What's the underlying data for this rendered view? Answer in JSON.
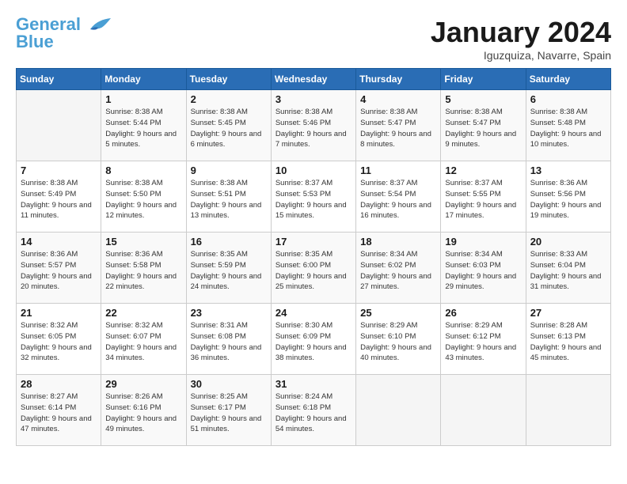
{
  "logo": {
    "line1": "General",
    "line2": "Blue"
  },
  "title": "January 2024",
  "location": "Iguzquiza, Navarre, Spain",
  "weekdays": [
    "Sunday",
    "Monday",
    "Tuesday",
    "Wednesday",
    "Thursday",
    "Friday",
    "Saturday"
  ],
  "weeks": [
    [
      {
        "day": null
      },
      {
        "day": 1,
        "sunrise": "8:38 AM",
        "sunset": "5:44 PM",
        "daylight": "9 hours and 5 minutes."
      },
      {
        "day": 2,
        "sunrise": "8:38 AM",
        "sunset": "5:45 PM",
        "daylight": "9 hours and 6 minutes."
      },
      {
        "day": 3,
        "sunrise": "8:38 AM",
        "sunset": "5:46 PM",
        "daylight": "9 hours and 7 minutes."
      },
      {
        "day": 4,
        "sunrise": "8:38 AM",
        "sunset": "5:47 PM",
        "daylight": "9 hours and 8 minutes."
      },
      {
        "day": 5,
        "sunrise": "8:38 AM",
        "sunset": "5:47 PM",
        "daylight": "9 hours and 9 minutes."
      },
      {
        "day": 6,
        "sunrise": "8:38 AM",
        "sunset": "5:48 PM",
        "daylight": "9 hours and 10 minutes."
      }
    ],
    [
      {
        "day": 7,
        "sunrise": "8:38 AM",
        "sunset": "5:49 PM",
        "daylight": "9 hours and 11 minutes."
      },
      {
        "day": 8,
        "sunrise": "8:38 AM",
        "sunset": "5:50 PM",
        "daylight": "9 hours and 12 minutes."
      },
      {
        "day": 9,
        "sunrise": "8:38 AM",
        "sunset": "5:51 PM",
        "daylight": "9 hours and 13 minutes."
      },
      {
        "day": 10,
        "sunrise": "8:37 AM",
        "sunset": "5:53 PM",
        "daylight": "9 hours and 15 minutes."
      },
      {
        "day": 11,
        "sunrise": "8:37 AM",
        "sunset": "5:54 PM",
        "daylight": "9 hours and 16 minutes."
      },
      {
        "day": 12,
        "sunrise": "8:37 AM",
        "sunset": "5:55 PM",
        "daylight": "9 hours and 17 minutes."
      },
      {
        "day": 13,
        "sunrise": "8:36 AM",
        "sunset": "5:56 PM",
        "daylight": "9 hours and 19 minutes."
      }
    ],
    [
      {
        "day": 14,
        "sunrise": "8:36 AM",
        "sunset": "5:57 PM",
        "daylight": "9 hours and 20 minutes."
      },
      {
        "day": 15,
        "sunrise": "8:36 AM",
        "sunset": "5:58 PM",
        "daylight": "9 hours and 22 minutes."
      },
      {
        "day": 16,
        "sunrise": "8:35 AM",
        "sunset": "5:59 PM",
        "daylight": "9 hours and 24 minutes."
      },
      {
        "day": 17,
        "sunrise": "8:35 AM",
        "sunset": "6:00 PM",
        "daylight": "9 hours and 25 minutes."
      },
      {
        "day": 18,
        "sunrise": "8:34 AM",
        "sunset": "6:02 PM",
        "daylight": "9 hours and 27 minutes."
      },
      {
        "day": 19,
        "sunrise": "8:34 AM",
        "sunset": "6:03 PM",
        "daylight": "9 hours and 29 minutes."
      },
      {
        "day": 20,
        "sunrise": "8:33 AM",
        "sunset": "6:04 PM",
        "daylight": "9 hours and 31 minutes."
      }
    ],
    [
      {
        "day": 21,
        "sunrise": "8:32 AM",
        "sunset": "6:05 PM",
        "daylight": "9 hours and 32 minutes."
      },
      {
        "day": 22,
        "sunrise": "8:32 AM",
        "sunset": "6:07 PM",
        "daylight": "9 hours and 34 minutes."
      },
      {
        "day": 23,
        "sunrise": "8:31 AM",
        "sunset": "6:08 PM",
        "daylight": "9 hours and 36 minutes."
      },
      {
        "day": 24,
        "sunrise": "8:30 AM",
        "sunset": "6:09 PM",
        "daylight": "9 hours and 38 minutes."
      },
      {
        "day": 25,
        "sunrise": "8:29 AM",
        "sunset": "6:10 PM",
        "daylight": "9 hours and 40 minutes."
      },
      {
        "day": 26,
        "sunrise": "8:29 AM",
        "sunset": "6:12 PM",
        "daylight": "9 hours and 43 minutes."
      },
      {
        "day": 27,
        "sunrise": "8:28 AM",
        "sunset": "6:13 PM",
        "daylight": "9 hours and 45 minutes."
      }
    ],
    [
      {
        "day": 28,
        "sunrise": "8:27 AM",
        "sunset": "6:14 PM",
        "daylight": "9 hours and 47 minutes."
      },
      {
        "day": 29,
        "sunrise": "8:26 AM",
        "sunset": "6:16 PM",
        "daylight": "9 hours and 49 minutes."
      },
      {
        "day": 30,
        "sunrise": "8:25 AM",
        "sunset": "6:17 PM",
        "daylight": "9 hours and 51 minutes."
      },
      {
        "day": 31,
        "sunrise": "8:24 AM",
        "sunset": "6:18 PM",
        "daylight": "9 hours and 54 minutes."
      },
      {
        "day": null
      },
      {
        "day": null
      },
      {
        "day": null
      }
    ]
  ]
}
